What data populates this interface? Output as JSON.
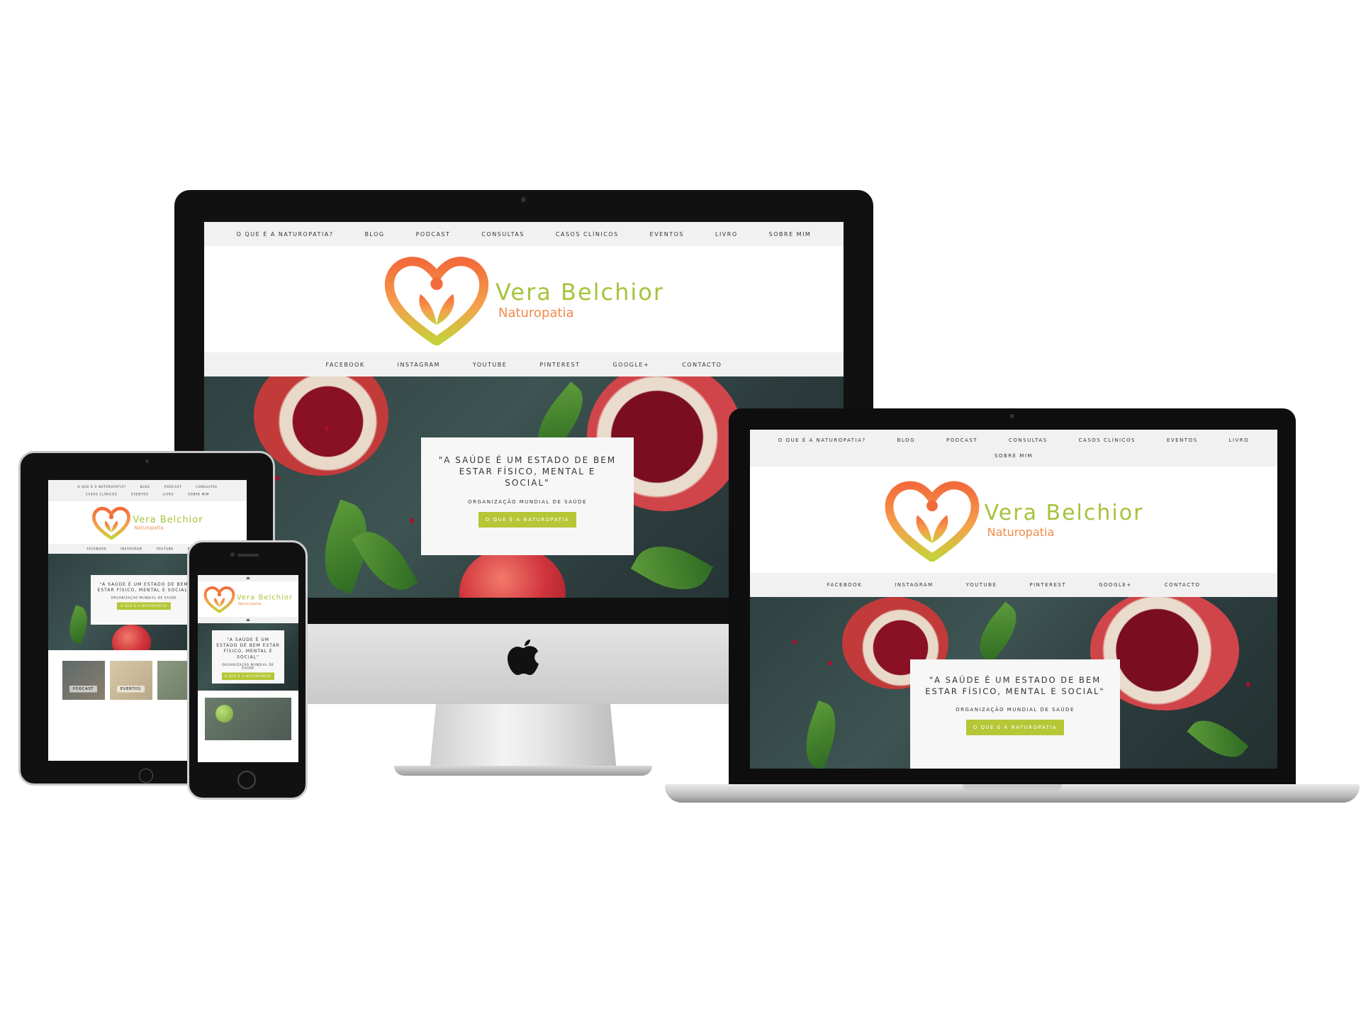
{
  "site": {
    "top_nav": [
      "O que é a Naturopatia?",
      "Blog",
      "Podcast",
      "Consultas",
      "Casos Clínicos",
      "Eventos",
      "Livro",
      "Sobre mim"
    ],
    "brand_name": "Vera Belchior",
    "brand_subtitle": "Naturopatia",
    "social_nav": [
      "Facebook",
      "Instagram",
      "Youtube",
      "Pinterest",
      "Google+",
      "Contacto"
    ],
    "hero_quote": "\"A saúde é um estado de bem estar físico, mental e social\"",
    "hero_author": "Organização Mundial de Saúde",
    "hero_button": "O que é a Naturopatia",
    "mobile_menu_icon": "≡",
    "tablet_card_labels": [
      "Podcast",
      "Eventos"
    ]
  },
  "colors": {
    "accent_green": "#b5c637",
    "brand_green": "#a6c33b",
    "brand_orange": "#f08a4b",
    "nav_bg": "#f1f1f1"
  },
  "icons": {
    "apple": "apple-logo-icon",
    "logo": "heart-leaf-person-icon",
    "menu": "hamburger-menu-icon"
  }
}
